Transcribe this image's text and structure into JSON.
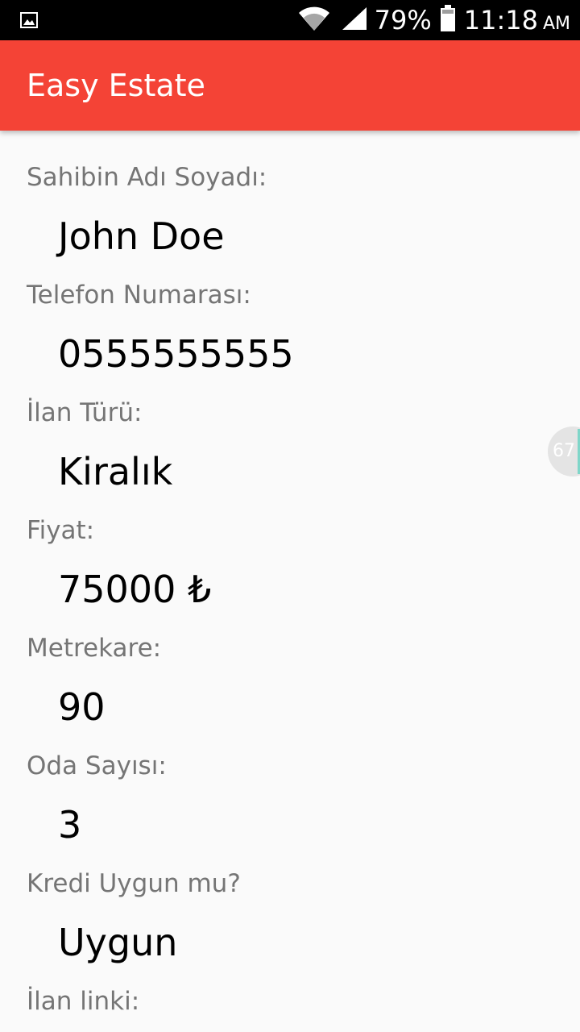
{
  "status_bar": {
    "notification_icon": "image-notification-icon",
    "wifi_icon": "wifi-icon",
    "signal_icon": "cell-signal-icon",
    "battery_percent": "79%",
    "battery_icon": "battery-icon",
    "time": "11:18",
    "ampm": "AM"
  },
  "app_bar": {
    "title": "Easy Estate",
    "color": "#f44336"
  },
  "fields": [
    {
      "label": "Sahibin Adı Soyadı:",
      "value": "John Doe"
    },
    {
      "label": "Telefon Numarası:",
      "value": "0555555555"
    },
    {
      "label": "İlan Türü:",
      "value": "Kiralık"
    },
    {
      "label": "Fiyat:",
      "value": "75000 ₺"
    },
    {
      "label": "Metrekare:",
      "value": "90"
    },
    {
      "label": "Oda Sayısı:",
      "value": "3"
    },
    {
      "label": "Kredi Uygun mu?",
      "value": "Uygun"
    },
    {
      "label": "İlan linki:",
      "value": ""
    }
  ],
  "floating_badge": {
    "text": "67"
  }
}
